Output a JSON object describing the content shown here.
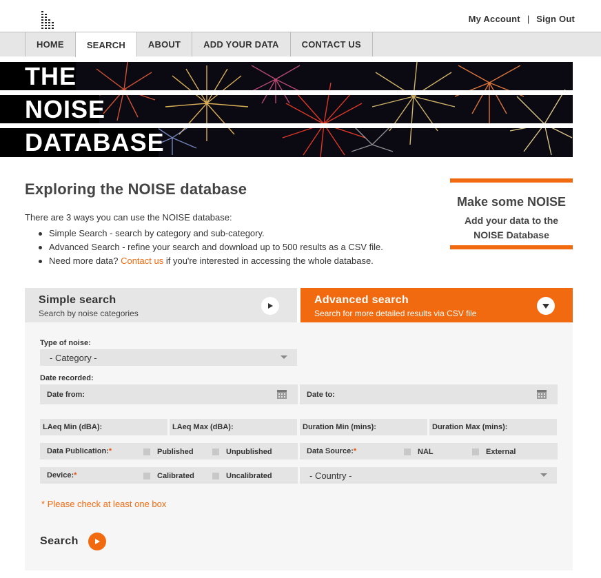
{
  "header": {
    "my_account": "My Account",
    "separator": "|",
    "sign_out": "Sign Out"
  },
  "nav": {
    "items": [
      "HOME",
      "SEARCH",
      "ABOUT",
      "ADD YOUR DATA",
      "CONTACT US"
    ],
    "active": "SEARCH"
  },
  "banner": {
    "line1": "THE",
    "line2": "NOISE",
    "line3": "DATABASE"
  },
  "intro": {
    "title": "Exploring the NOISE database",
    "lead": "There are 3 ways you can use the NOISE database:",
    "item1": "Simple Search - search by category and sub-category.",
    "item2": "Advanced Search - refine your search and download up to 500 results as a CSV file.",
    "item3_pre": "Need more data? ",
    "item3_link": "Contact us",
    "item3_post": " if you're interested in accessing the whole database."
  },
  "cta": {
    "title": "Make some NOISE",
    "line1": "Add your data to the",
    "line2": "NOISE Database"
  },
  "tabs": {
    "simple_title": "Simple search",
    "simple_sub": "Search by noise categories",
    "adv_title": "Advanced search",
    "adv_sub": "Search for more detailed results via CSV file"
  },
  "form": {
    "type_label": "Type of noise:",
    "category_select": "- Category -",
    "date_label": "Date recorded:",
    "date_from": "Date from:",
    "date_to": "Date to:",
    "laeq_min": "LAeq Min (dBA):",
    "laeq_max": "LAeq Max (dBA):",
    "duration_min": "Duration Min (mins):",
    "duration_max": "Duration Max (mins):",
    "publication_label": "Data Publication:",
    "published": "Published",
    "unpublished": "Unpublished",
    "source_label": "Data Source:",
    "nal": "NAL",
    "external": "External",
    "device_label": "Device:",
    "calibrated": "Calibrated",
    "uncalibrated": "Uncalibrated",
    "country_select": "- Country -",
    "required_mark": "*",
    "note": "* Please check at least one box",
    "search_label": "Search"
  },
  "colors": {
    "accent": "#f26a10",
    "nav_bg": "#e6e6e6",
    "form_bg": "#f6f6f6",
    "field_bg": "#e4e4e4"
  },
  "icons": {
    "logo": "equalizer-bars-icon",
    "calendar": "calendar-icon",
    "play": "play-icon",
    "chevron": "chevron-down-icon"
  }
}
